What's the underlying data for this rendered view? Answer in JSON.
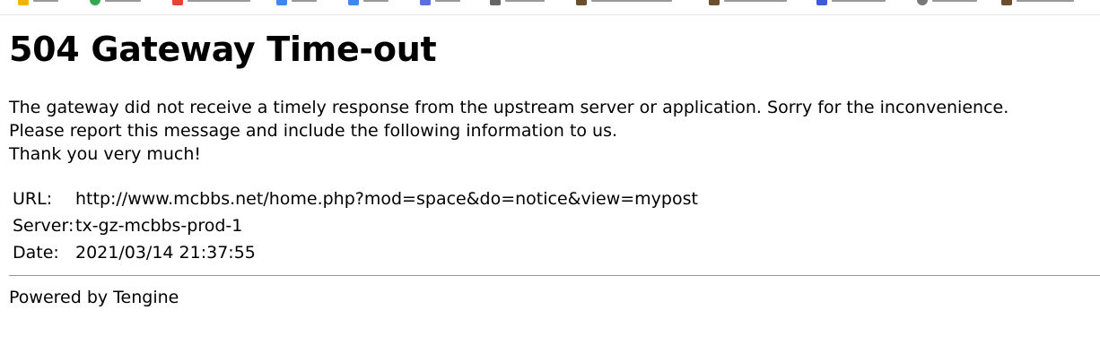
{
  "page": {
    "title": "504 Gateway Time-out",
    "message_lines": [
      "The gateway did not receive a timely response from the upstream server or application. Sorry for the inconvenience.",
      "Please report this message and include the following information to us.",
      "Thank you very much!"
    ],
    "info": [
      {
        "label": "URL:",
        "value": "http://www.mcbbs.net/home.php?mod=space&do=notice&view=mypost"
      },
      {
        "label": "Server:",
        "value": "tx-gz-mcbbs-prod-1"
      },
      {
        "label": "Date:",
        "value": "2021/03/14 21:37:55"
      }
    ],
    "footer": "Powered by Tengine"
  },
  "bookmarks": [
    {
      "icon": "apps-icon",
      "color": "#f4b400"
    },
    {
      "icon": "green-site-icon",
      "color": "#34a853"
    },
    {
      "icon": "red-site-icon",
      "color": "#ea4335"
    },
    {
      "icon": "doc-icon",
      "color": "#4285f4"
    },
    {
      "icon": "doc-icon",
      "color": "#4285f4"
    },
    {
      "icon": "blue-site-icon",
      "color": "#5b6ee1"
    },
    {
      "icon": "grid-icon",
      "color": "#666666"
    },
    {
      "icon": "minecraft-icon",
      "color": "#6b4f2c"
    },
    {
      "icon": "minecraft-icon",
      "color": "#6b4f2c"
    },
    {
      "icon": "blue-site-icon",
      "color": "#3b5bdb"
    },
    {
      "icon": "globe-icon",
      "color": "#777777"
    },
    {
      "icon": "minecraft-icon",
      "color": "#6b4f2c"
    }
  ]
}
